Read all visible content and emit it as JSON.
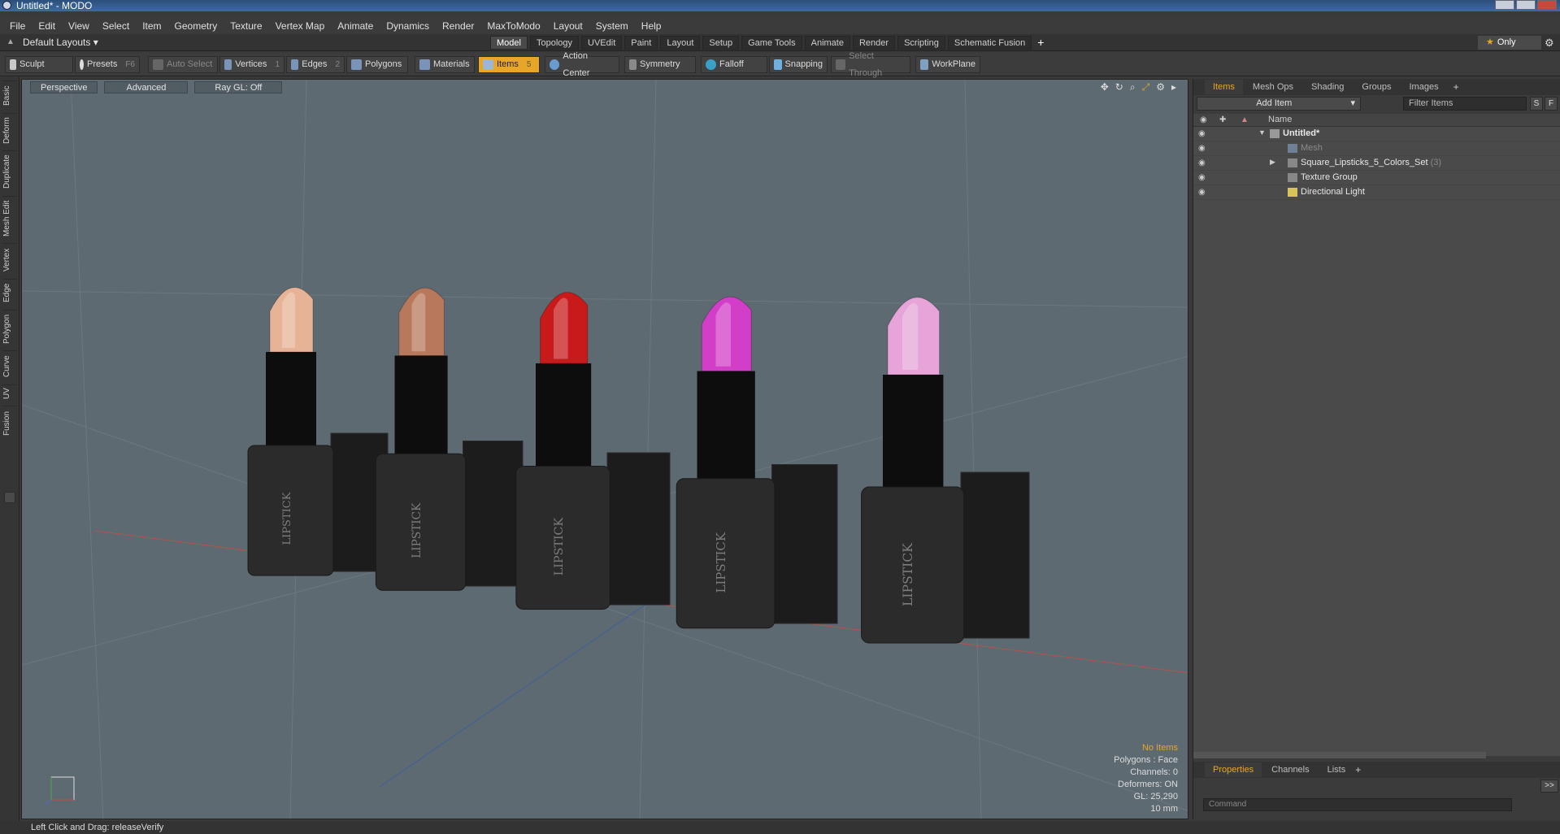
{
  "window": {
    "title": "Untitled* - MODO"
  },
  "menu": [
    "File",
    "Edit",
    "View",
    "Select",
    "Item",
    "Geometry",
    "Texture",
    "Vertex Map",
    "Animate",
    "Dynamics",
    "Render",
    "MaxToModo",
    "Layout",
    "System",
    "Help"
  ],
  "layout_dropdown": "Default Layouts",
  "tabs": [
    "Model",
    "Topology",
    "UVEdit",
    "Paint",
    "Layout",
    "Setup",
    "Game Tools",
    "Animate",
    "Render",
    "Scripting",
    "Schematic Fusion"
  ],
  "active_tab": "Model",
  "only_label": "Only",
  "toolbar": {
    "sculpt": "Sculpt",
    "presets": "Presets",
    "presets_key": "F6",
    "auto_select": "Auto Select",
    "vertices": "Vertices",
    "vertices_key": "1",
    "edges": "Edges",
    "edges_key": "2",
    "polygons": "Polygons",
    "materials": "Materials",
    "items": "Items",
    "items_key": "5",
    "action_center": "Action Center",
    "symmetry": "Symmetry",
    "falloff": "Falloff",
    "snapping": "Snapping",
    "select_through": "Select Through",
    "workplane": "WorkPlane"
  },
  "left_tabs": [
    "Basic",
    "Deform",
    "Duplicate",
    "Mesh Edit",
    "Vertex",
    "Edge",
    "Polygon",
    "Curve",
    "UV",
    "Fusion"
  ],
  "viewport": {
    "perspective": "Perspective",
    "advanced": "Advanced",
    "raygl": "Ray GL: Off",
    "info": {
      "no_items": "No Items",
      "polygons": "Polygons : Face",
      "channels": "Channels: 0",
      "deformers": "Deformers: ON",
      "gl": "GL: 25,290",
      "scale": "10 mm"
    },
    "lipstick_label": "LIPSTICK",
    "lipstick_colors": [
      "#e7b396",
      "#b8785c",
      "#c81a1a",
      "#d23ec8",
      "#e6a4d8"
    ]
  },
  "right_panel": {
    "tabs": [
      "Items",
      "Mesh Ops",
      "Shading",
      "Groups",
      "Images"
    ],
    "add_item": "Add Item",
    "filter_placeholder": "Filter Items",
    "s_btn": "S",
    "f_btn": "F",
    "name_header": "Name",
    "tree": [
      {
        "label": "Untitled*",
        "style": "bold"
      },
      {
        "label": "Mesh",
        "style": "dim"
      },
      {
        "label": "Square_Lipsticks_5_Colors_Set",
        "count": "(3)"
      },
      {
        "label": "Texture Group"
      },
      {
        "label": "Directional Light"
      }
    ],
    "bottom_tabs": [
      "Properties",
      "Channels",
      "Lists"
    ],
    "expand_btn": ">>",
    "command_placeholder": "Command"
  },
  "status": {
    "text": "Left Click and Drag:  releaseVerify"
  }
}
